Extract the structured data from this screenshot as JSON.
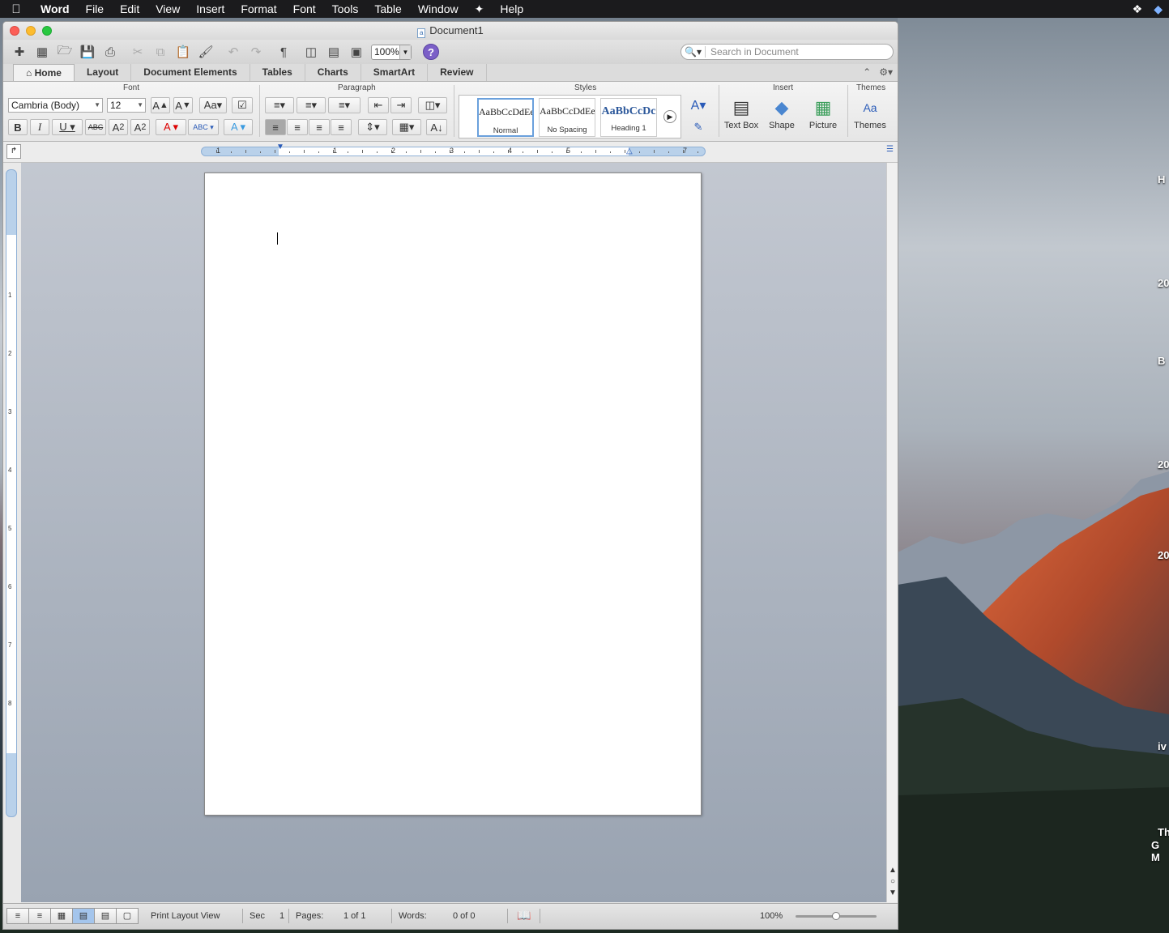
{
  "menubar": {
    "items": [
      "Word",
      "File",
      "Edit",
      "View",
      "Insert",
      "Format",
      "Font",
      "Tools",
      "Table",
      "Window",
      "Help"
    ]
  },
  "window": {
    "title": "Document1"
  },
  "toolbar": {
    "zoom": "100%",
    "search_placeholder": "Search in Document"
  },
  "tabs": [
    "Home",
    "Layout",
    "Document Elements",
    "Tables",
    "Charts",
    "SmartArt",
    "Review"
  ],
  "ribbon": {
    "groups": {
      "font": "Font",
      "paragraph": "Paragraph",
      "styles": "Styles",
      "insert": "Insert",
      "themes": "Themes"
    },
    "font_name": "Cambria (Body)",
    "font_size": "12",
    "style_sample": "AaBbCcDdEe",
    "heading_sample": "AaBbCcDc",
    "styles": [
      "Normal",
      "No Spacing",
      "Heading 1"
    ],
    "insert_buttons": [
      "Text Box",
      "Shape",
      "Picture"
    ],
    "themes_button": "Themes"
  },
  "ruler": {
    "numbers": [
      "1",
      "1",
      "2",
      "3",
      "4",
      "5",
      "7"
    ]
  },
  "vruler": {
    "numbers": [
      "1",
      "2",
      "3",
      "4",
      "5",
      "6",
      "7",
      "8"
    ]
  },
  "statusbar": {
    "view": "Print Layout View",
    "sec_label": "Sec",
    "sec_value": "1",
    "pages_label": "Pages:",
    "pages_value": "1 of 1",
    "words_label": "Words:",
    "words_value": "0 of 0",
    "zoom": "100%"
  },
  "desktop_labels": [
    "H",
    "20",
    "B",
    "20",
    "20",
    "iv",
    "Th",
    "G M"
  ]
}
